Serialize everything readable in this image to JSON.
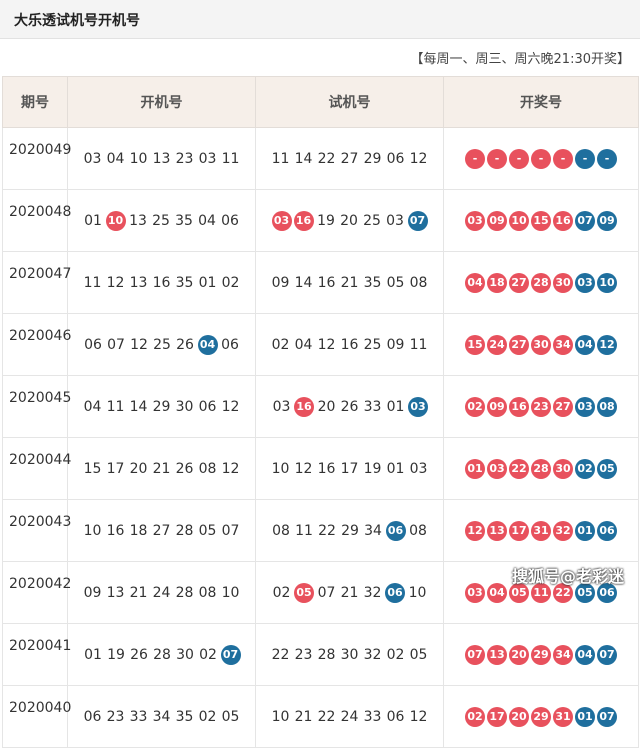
{
  "header": {
    "title": "大乐透试机号开机号"
  },
  "schedule": "【每周一、周三、周六晚21:30开奖】",
  "columns": [
    "期号",
    "开机号",
    "试机号",
    "开奖号"
  ],
  "colors": {
    "red": "#e8515d",
    "blue": "#1f6f9e"
  },
  "rows": [
    {
      "period": "2020049",
      "open": [
        [
          "03",
          "plain"
        ],
        [
          "04",
          "plain"
        ],
        [
          "10",
          "plain"
        ],
        [
          "13",
          "plain"
        ],
        [
          "23",
          "plain"
        ],
        [
          "03",
          "plain"
        ],
        [
          "11",
          "plain"
        ]
      ],
      "trial": [
        [
          "11",
          "plain"
        ],
        [
          "14",
          "plain"
        ],
        [
          "22",
          "plain"
        ],
        [
          "27",
          "plain"
        ],
        [
          "29",
          "plain"
        ],
        [
          "06",
          "plain"
        ],
        [
          "12",
          "plain"
        ]
      ],
      "draw": [
        [
          "-",
          "red"
        ],
        [
          "-",
          "red"
        ],
        [
          "-",
          "red"
        ],
        [
          "-",
          "red"
        ],
        [
          "-",
          "red"
        ],
        [
          "-",
          "blue"
        ],
        [
          "-",
          "blue"
        ]
      ]
    },
    {
      "period": "2020048",
      "open": [
        [
          "01",
          "plain"
        ],
        [
          "10",
          "red"
        ],
        [
          "13",
          "plain"
        ],
        [
          "25",
          "plain"
        ],
        [
          "35",
          "plain"
        ],
        [
          "04",
          "plain"
        ],
        [
          "06",
          "plain"
        ]
      ],
      "trial": [
        [
          "03",
          "red"
        ],
        [
          "16",
          "red"
        ],
        [
          "19",
          "plain"
        ],
        [
          "20",
          "plain"
        ],
        [
          "25",
          "plain"
        ],
        [
          "03",
          "plain"
        ],
        [
          "07",
          "blue"
        ]
      ],
      "draw": [
        [
          "03",
          "red"
        ],
        [
          "09",
          "red"
        ],
        [
          "10",
          "red"
        ],
        [
          "15",
          "red"
        ],
        [
          "16",
          "red"
        ],
        [
          "07",
          "blue"
        ],
        [
          "09",
          "blue"
        ]
      ]
    },
    {
      "period": "2020047",
      "open": [
        [
          "11",
          "plain"
        ],
        [
          "12",
          "plain"
        ],
        [
          "13",
          "plain"
        ],
        [
          "16",
          "plain"
        ],
        [
          "35",
          "plain"
        ],
        [
          "01",
          "plain"
        ],
        [
          "02",
          "plain"
        ]
      ],
      "trial": [
        [
          "09",
          "plain"
        ],
        [
          "14",
          "plain"
        ],
        [
          "16",
          "plain"
        ],
        [
          "21",
          "plain"
        ],
        [
          "35",
          "plain"
        ],
        [
          "05",
          "plain"
        ],
        [
          "08",
          "plain"
        ]
      ],
      "draw": [
        [
          "04",
          "red"
        ],
        [
          "18",
          "red"
        ],
        [
          "27",
          "red"
        ],
        [
          "28",
          "red"
        ],
        [
          "30",
          "red"
        ],
        [
          "03",
          "blue"
        ],
        [
          "10",
          "blue"
        ]
      ]
    },
    {
      "period": "2020046",
      "open": [
        [
          "06",
          "plain"
        ],
        [
          "07",
          "plain"
        ],
        [
          "12",
          "plain"
        ],
        [
          "25",
          "plain"
        ],
        [
          "26",
          "plain"
        ],
        [
          "04",
          "blue"
        ],
        [
          "06",
          "plain"
        ]
      ],
      "trial": [
        [
          "02",
          "plain"
        ],
        [
          "04",
          "plain"
        ],
        [
          "12",
          "plain"
        ],
        [
          "16",
          "plain"
        ],
        [
          "25",
          "plain"
        ],
        [
          "09",
          "plain"
        ],
        [
          "11",
          "plain"
        ]
      ],
      "draw": [
        [
          "15",
          "red"
        ],
        [
          "24",
          "red"
        ],
        [
          "27",
          "red"
        ],
        [
          "30",
          "red"
        ],
        [
          "34",
          "red"
        ],
        [
          "04",
          "blue"
        ],
        [
          "12",
          "blue"
        ]
      ]
    },
    {
      "period": "2020045",
      "open": [
        [
          "04",
          "plain"
        ],
        [
          "11",
          "plain"
        ],
        [
          "14",
          "plain"
        ],
        [
          "29",
          "plain"
        ],
        [
          "30",
          "plain"
        ],
        [
          "06",
          "plain"
        ],
        [
          "12",
          "plain"
        ]
      ],
      "trial": [
        [
          "03",
          "plain"
        ],
        [
          "16",
          "red"
        ],
        [
          "20",
          "plain"
        ],
        [
          "26",
          "plain"
        ],
        [
          "33",
          "plain"
        ],
        [
          "01",
          "plain"
        ],
        [
          "03",
          "blue"
        ]
      ],
      "draw": [
        [
          "02",
          "red"
        ],
        [
          "09",
          "red"
        ],
        [
          "16",
          "red"
        ],
        [
          "23",
          "red"
        ],
        [
          "27",
          "red"
        ],
        [
          "03",
          "blue"
        ],
        [
          "08",
          "blue"
        ]
      ]
    },
    {
      "period": "2020044",
      "open": [
        [
          "15",
          "plain"
        ],
        [
          "17",
          "plain"
        ],
        [
          "20",
          "plain"
        ],
        [
          "21",
          "plain"
        ],
        [
          "26",
          "plain"
        ],
        [
          "08",
          "plain"
        ],
        [
          "12",
          "plain"
        ]
      ],
      "trial": [
        [
          "10",
          "plain"
        ],
        [
          "12",
          "plain"
        ],
        [
          "16",
          "plain"
        ],
        [
          "17",
          "plain"
        ],
        [
          "19",
          "plain"
        ],
        [
          "01",
          "plain"
        ],
        [
          "03",
          "plain"
        ]
      ],
      "draw": [
        [
          "01",
          "red"
        ],
        [
          "03",
          "red"
        ],
        [
          "22",
          "red"
        ],
        [
          "28",
          "red"
        ],
        [
          "30",
          "red"
        ],
        [
          "02",
          "blue"
        ],
        [
          "05",
          "blue"
        ]
      ]
    },
    {
      "period": "2020043",
      "open": [
        [
          "10",
          "plain"
        ],
        [
          "16",
          "plain"
        ],
        [
          "18",
          "plain"
        ],
        [
          "27",
          "plain"
        ],
        [
          "28",
          "plain"
        ],
        [
          "05",
          "plain"
        ],
        [
          "07",
          "plain"
        ]
      ],
      "trial": [
        [
          "08",
          "plain"
        ],
        [
          "11",
          "plain"
        ],
        [
          "22",
          "plain"
        ],
        [
          "29",
          "plain"
        ],
        [
          "34",
          "plain"
        ],
        [
          "06",
          "blue"
        ],
        [
          "08",
          "plain"
        ]
      ],
      "draw": [
        [
          "12",
          "red"
        ],
        [
          "13",
          "red"
        ],
        [
          "17",
          "red"
        ],
        [
          "31",
          "red"
        ],
        [
          "32",
          "red"
        ],
        [
          "01",
          "blue"
        ],
        [
          "06",
          "blue"
        ]
      ]
    },
    {
      "period": "2020042",
      "open": [
        [
          "09",
          "plain"
        ],
        [
          "13",
          "plain"
        ],
        [
          "21",
          "plain"
        ],
        [
          "24",
          "plain"
        ],
        [
          "28",
          "plain"
        ],
        [
          "08",
          "plain"
        ],
        [
          "10",
          "plain"
        ]
      ],
      "trial": [
        [
          "02",
          "plain"
        ],
        [
          "05",
          "red"
        ],
        [
          "07",
          "plain"
        ],
        [
          "21",
          "plain"
        ],
        [
          "32",
          "plain"
        ],
        [
          "06",
          "blue"
        ],
        [
          "10",
          "plain"
        ]
      ],
      "draw": [
        [
          "03",
          "red"
        ],
        [
          "04",
          "red"
        ],
        [
          "05",
          "red"
        ],
        [
          "11",
          "red"
        ],
        [
          "22",
          "red"
        ],
        [
          "05",
          "blue"
        ],
        [
          "06",
          "blue"
        ]
      ]
    },
    {
      "period": "2020041",
      "open": [
        [
          "01",
          "plain"
        ],
        [
          "19",
          "plain"
        ],
        [
          "26",
          "plain"
        ],
        [
          "28",
          "plain"
        ],
        [
          "30",
          "plain"
        ],
        [
          "02",
          "plain"
        ],
        [
          "07",
          "blue"
        ]
      ],
      "trial": [
        [
          "22",
          "plain"
        ],
        [
          "23",
          "plain"
        ],
        [
          "28",
          "plain"
        ],
        [
          "30",
          "plain"
        ],
        [
          "32",
          "plain"
        ],
        [
          "02",
          "plain"
        ],
        [
          "05",
          "plain"
        ]
      ],
      "draw": [
        [
          "07",
          "red"
        ],
        [
          "13",
          "red"
        ],
        [
          "20",
          "red"
        ],
        [
          "29",
          "red"
        ],
        [
          "34",
          "red"
        ],
        [
          "04",
          "blue"
        ],
        [
          "07",
          "blue"
        ]
      ]
    },
    {
      "period": "2020040",
      "open": [
        [
          "06",
          "plain"
        ],
        [
          "23",
          "plain"
        ],
        [
          "33",
          "plain"
        ],
        [
          "34",
          "plain"
        ],
        [
          "35",
          "plain"
        ],
        [
          "02",
          "plain"
        ],
        [
          "05",
          "plain"
        ]
      ],
      "trial": [
        [
          "10",
          "plain"
        ],
        [
          "21",
          "plain"
        ],
        [
          "22",
          "plain"
        ],
        [
          "24",
          "plain"
        ],
        [
          "33",
          "plain"
        ],
        [
          "06",
          "plain"
        ],
        [
          "12",
          "plain"
        ]
      ],
      "draw": [
        [
          "02",
          "red"
        ],
        [
          "17",
          "red"
        ],
        [
          "20",
          "red"
        ],
        [
          "29",
          "red"
        ],
        [
          "31",
          "red"
        ],
        [
          "01",
          "blue"
        ],
        [
          "07",
          "blue"
        ]
      ]
    }
  ],
  "watermark": "搜狐号@老彩迷"
}
